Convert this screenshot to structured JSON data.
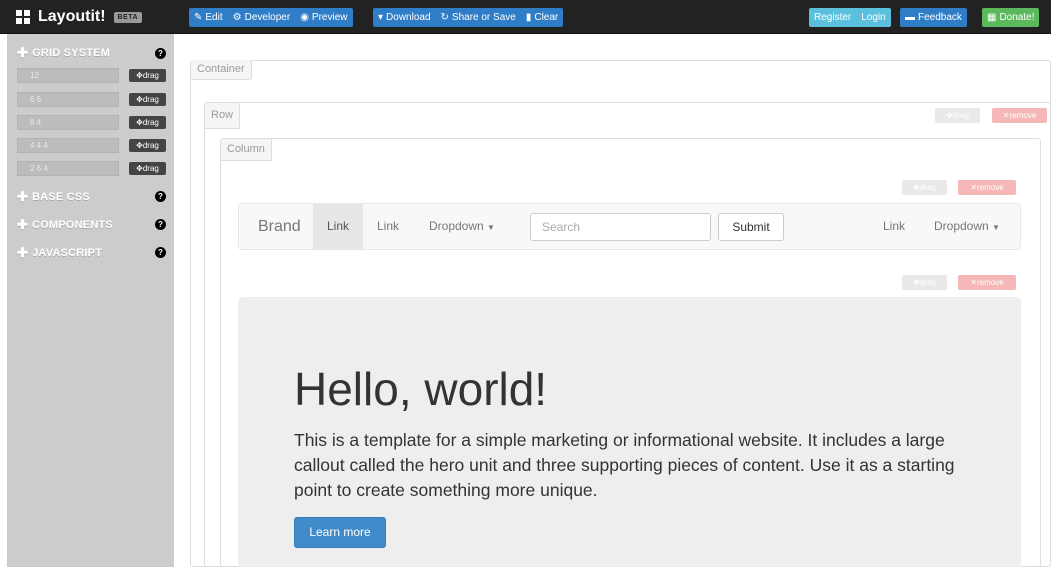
{
  "app": {
    "title": "Layoutit!",
    "badge": "BETA"
  },
  "toolbar": {
    "edit": "Edit",
    "developer": "Developer",
    "preview": "Preview",
    "download": "Download",
    "share": "Share or Save",
    "clear": "Clear",
    "register": "Register",
    "login": "Login",
    "feedback": "Feedback",
    "donate": "Donate!"
  },
  "sidebar": {
    "sections": [
      {
        "label": "GRID SYSTEM"
      },
      {
        "label": "BASE CSS"
      },
      {
        "label": "COMPONENTS"
      },
      {
        "label": "JAVASCRIPT"
      }
    ],
    "grid_rows": [
      {
        "value": "12",
        "drag": "drag"
      },
      {
        "value": "6 6",
        "drag": "drag"
      },
      {
        "value": "8 4",
        "drag": "drag"
      },
      {
        "value": "4 4 4",
        "drag": "drag"
      },
      {
        "value": "2 6 4",
        "drag": "drag"
      }
    ],
    "help_glyph": "?"
  },
  "canvas": {
    "container_label": "Container",
    "row_label": "Row",
    "column_label": "Column",
    "drag_label": "drag",
    "remove_label": "remove"
  },
  "navbar": {
    "brand": "Brand",
    "link1": "Link",
    "link2": "Link",
    "dropdown1": "Dropdown",
    "search_placeholder": "Search",
    "submit": "Submit",
    "link3": "Link",
    "dropdown2": "Dropdown"
  },
  "hero": {
    "heading": "Hello, world!",
    "text": "This is a template for a simple marketing or informational website. It includes a large callout called the hero unit and three supporting pieces of content. Use it as a starting point to create something more unique.",
    "button": "Learn more"
  },
  "colors": {
    "topbar": "#222222",
    "primary": "#2f7dc6",
    "info": "#5bc0de",
    "success": "#5cb85c",
    "sidebar": "#cccccc",
    "hero_bg": "#eeeeee"
  }
}
